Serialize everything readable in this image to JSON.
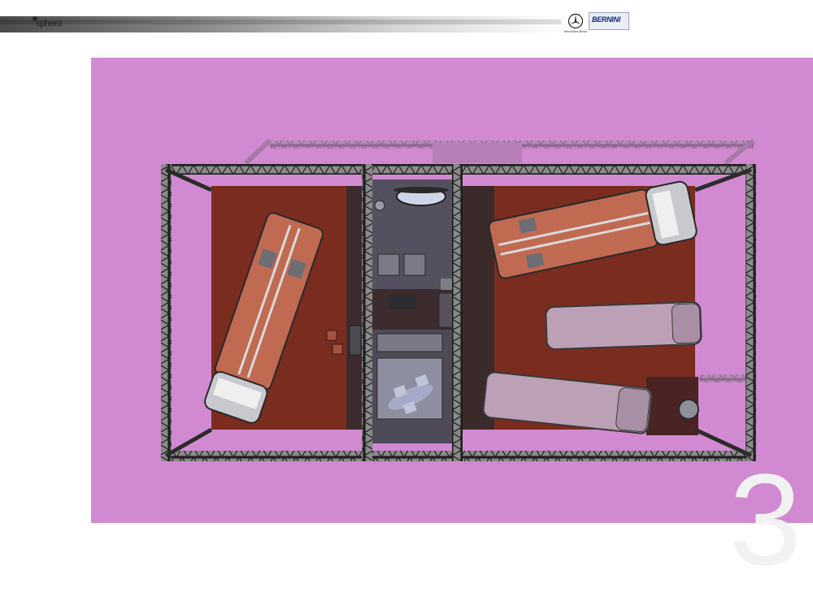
{
  "header": {
    "brand": "sphero",
    "partner_small_text": "Mercedes-Benz",
    "partner_badge": "BERNINI"
  },
  "page_number": "3",
  "colors": {
    "background": "#d18ad1",
    "floor": "#7a2c1e",
    "truss": "#2b2b2b",
    "center_room": "#4a4a56"
  },
  "icons": [
    "mercedes-star-icon",
    "truss-frame",
    "bus-top-view",
    "van-top-view"
  ]
}
